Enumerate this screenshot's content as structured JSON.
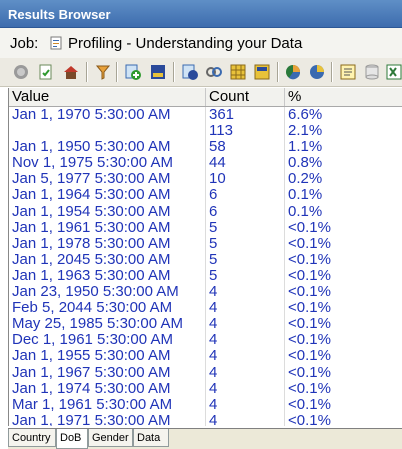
{
  "window": {
    "title": "Results Browser"
  },
  "job": {
    "label": "Job:",
    "name": "Profiling - Understanding your Data"
  },
  "toolbar": {
    "icons": [
      "stop-icon",
      "refresh-icon",
      "home-icon",
      "filter-icon",
      "add-icon",
      "export-icon",
      "drill-icon",
      "link-icon",
      "grid-icon",
      "table-icon",
      "pie-chart-icon",
      "chart-icon",
      "report-icon",
      "database-icon",
      "excel-icon"
    ]
  },
  "table": {
    "columns": [
      "Value",
      "Count",
      "%"
    ],
    "rows": [
      {
        "value": "Jan 1, 1970 5:30:00 AM",
        "count": "361",
        "pct": "6.6%"
      },
      {
        "value": "",
        "count": "113",
        "pct": "2.1%"
      },
      {
        "value": "Jan 1, 1950 5:30:00 AM",
        "count": "58",
        "pct": "1.1%"
      },
      {
        "value": "Nov 1, 1975 5:30:00 AM",
        "count": "44",
        "pct": "0.8%"
      },
      {
        "value": "Jan 5, 1977 5:30:00 AM",
        "count": "10",
        "pct": "0.2%"
      },
      {
        "value": "Jan 1, 1964 5:30:00 AM",
        "count": "6",
        "pct": "0.1%"
      },
      {
        "value": "Jan 1, 1954 5:30:00 AM",
        "count": "6",
        "pct": "0.1%"
      },
      {
        "value": "Jan 1, 1961 5:30:00 AM",
        "count": "5",
        "pct": "<0.1%"
      },
      {
        "value": "Jan 1, 1978 5:30:00 AM",
        "count": "5",
        "pct": "<0.1%"
      },
      {
        "value": "Jan 1, 2045 5:30:00 AM",
        "count": "5",
        "pct": "<0.1%"
      },
      {
        "value": "Jan 1, 1963 5:30:00 AM",
        "count": "5",
        "pct": "<0.1%"
      },
      {
        "value": "Jan 23, 1950 5:30:00 AM",
        "count": "4",
        "pct": "<0.1%"
      },
      {
        "value": "Feb 5, 2044 5:30:00 AM",
        "count": "4",
        "pct": "<0.1%"
      },
      {
        "value": "May 25, 1985 5:30:00 AM",
        "count": "4",
        "pct": "<0.1%"
      },
      {
        "value": "Dec 1, 1961 5:30:00 AM",
        "count": "4",
        "pct": "<0.1%"
      },
      {
        "value": "Jan 1, 1955 5:30:00 AM",
        "count": "4",
        "pct": "<0.1%"
      },
      {
        "value": "Jan 1, 1967 5:30:00 AM",
        "count": "4",
        "pct": "<0.1%"
      },
      {
        "value": "Jan 1, 1974 5:30:00 AM",
        "count": "4",
        "pct": "<0.1%"
      },
      {
        "value": "Mar 1, 1961 5:30:00 AM",
        "count": "4",
        "pct": "<0.1%"
      },
      {
        "value": "Jan 1, 1971 5:30:00 AM",
        "count": "4",
        "pct": "<0.1%"
      }
    ]
  },
  "tabs": [
    {
      "label": "Country",
      "active": false
    },
    {
      "label": "DoB",
      "active": true
    },
    {
      "label": "Gender",
      "active": false
    },
    {
      "label": "Data",
      "active": false
    }
  ],
  "colors": {
    "cell_text": "#2034b8",
    "title_bg": "#3d6cae"
  }
}
